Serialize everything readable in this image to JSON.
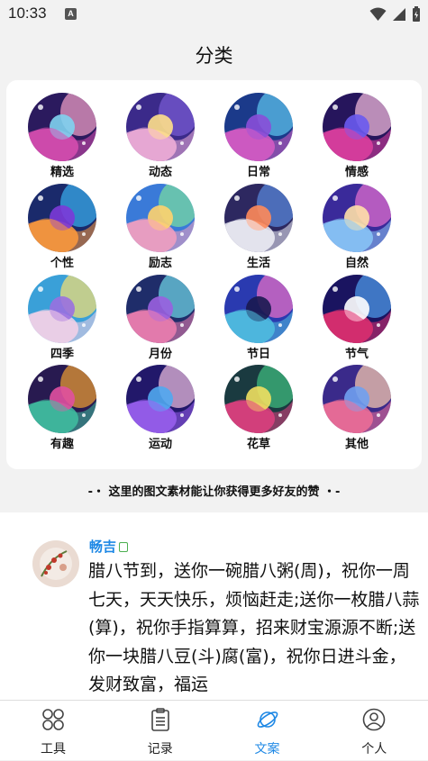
{
  "status_bar": {
    "time": "10:33",
    "notification_glyph": "A"
  },
  "page_title": "分类",
  "categories": [
    {
      "label": "精选"
    },
    {
      "label": "动态"
    },
    {
      "label": "日常"
    },
    {
      "label": "情感"
    },
    {
      "label": "个性"
    },
    {
      "label": "励志"
    },
    {
      "label": "生活"
    },
    {
      "label": "自然"
    },
    {
      "label": "四季"
    },
    {
      "label": "月份"
    },
    {
      "label": "节日"
    },
    {
      "label": "节气"
    },
    {
      "label": "有趣"
    },
    {
      "label": "运动"
    },
    {
      "label": "花草"
    },
    {
      "label": "其他"
    }
  ],
  "promo_text": "-・ 这里的图文素材能让你获得更多好友的赞 ・-",
  "post": {
    "username": "畅吉",
    "text": "腊八节到，送你一碗腊八粥(周)，祝你一周七天，天天快乐，烦恼赶走;送你一枚腊八蒜(算)，祝你手指算算，招来财宝源源不断;送你一块腊八豆(斗)腐(富)，祝你日进斗金，发财致富，福运"
  },
  "tabs": [
    {
      "label": "工具",
      "icon": "grid-circles-icon",
      "active": false
    },
    {
      "label": "记录",
      "icon": "clipboard-icon",
      "active": false
    },
    {
      "label": "文案",
      "icon": "planet-icon",
      "active": true
    },
    {
      "label": "个人",
      "icon": "person-icon",
      "active": false
    }
  ],
  "colors": {
    "accent": "#1e88e5",
    "background": "#f2f2f2"
  }
}
